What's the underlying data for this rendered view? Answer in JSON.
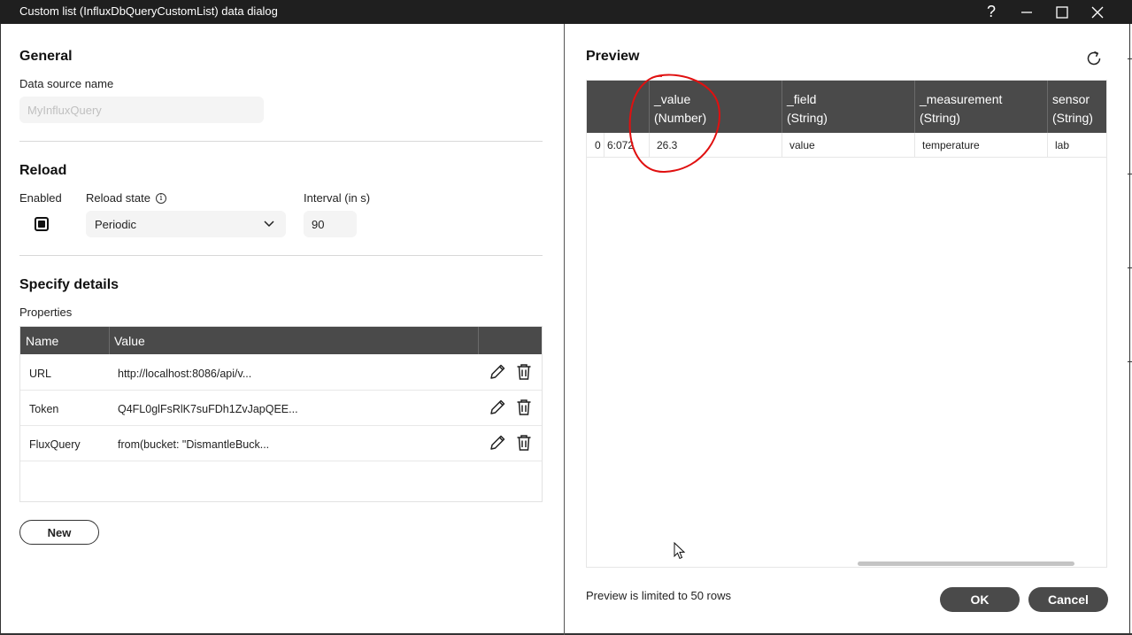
{
  "window": {
    "title": "Custom list (InfluxDbQueryCustomList) data dialog"
  },
  "general": {
    "heading": "General",
    "data_source_label": "Data source name",
    "data_source_placeholder": "MyInfluxQuery"
  },
  "reload": {
    "heading": "Reload",
    "enabled_label": "Enabled",
    "reload_state_label": "Reload state",
    "reload_state_value": "Periodic",
    "interval_label": "Interval (in s)",
    "interval_value": "90"
  },
  "details": {
    "heading": "Specify details",
    "properties_label": "Properties",
    "columns": [
      "Name",
      "Value"
    ],
    "rows": [
      {
        "name": "URL",
        "value": "http://localhost:8086/api/v..."
      },
      {
        "name": "Token",
        "value": "Q4FL0glFsRlK7suFDh1ZvJapQEE..."
      },
      {
        "name": "FluxQuery",
        "value": "from(bucket: \"DismantleBuck..."
      }
    ],
    "new_button": "New"
  },
  "preview": {
    "heading": "Preview",
    "columns": [
      {
        "name": "_value",
        "type": "(Number)"
      },
      {
        "name": "_field",
        "type": "(String)"
      },
      {
        "name": "_measurement",
        "type": "(String)"
      },
      {
        "name": "sensor",
        "type": "(String)"
      }
    ],
    "row": {
      "index": "0",
      "time_fragment": "6:072",
      "cells": [
        "26.3",
        "value",
        "temperature",
        "lab"
      ]
    },
    "limit_note": "Preview is limited to 50 rows"
  },
  "footer": {
    "ok": "OK",
    "cancel": "Cancel"
  },
  "colors": {
    "header_bg": "#4a4a4a",
    "titlebar_bg": "#1f1f1f",
    "annotation": "#e01010"
  }
}
